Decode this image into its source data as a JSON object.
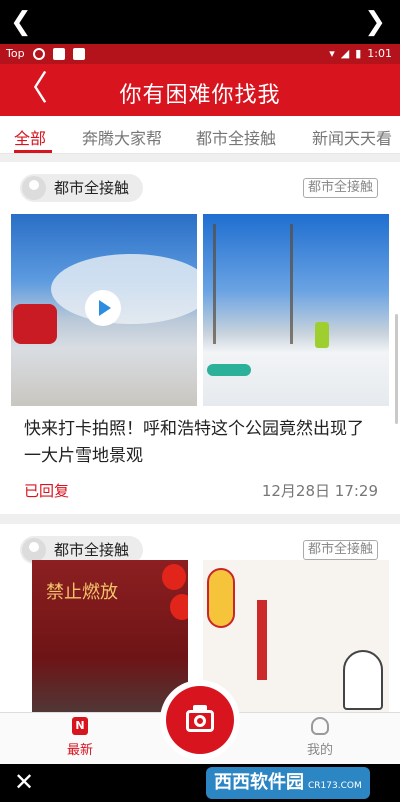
{
  "nav": {
    "prev_glyph": "❮",
    "next_glyph": "❯",
    "close_glyph": "✕"
  },
  "statusbar": {
    "left_app": "Top",
    "time": "1:01"
  },
  "header": {
    "back_glyph": "〈",
    "title": "你有困难你找我"
  },
  "tabs": [
    {
      "label": "全部",
      "active": true
    },
    {
      "label": "奔腾大家帮",
      "active": false
    },
    {
      "label": "都市全接触",
      "active": false
    },
    {
      "label": "新闻天天看",
      "active": false
    }
  ],
  "posts": [
    {
      "source": "都市全接触",
      "tag": "都市全接触",
      "headline": "快来打卡拍照！呼和浩特这个公园竟然出现了一大片雪地景观",
      "status": "已回复",
      "datetime": "12月28日 17:29"
    },
    {
      "source": "都市全接触",
      "tag": "都市全接触",
      "image_text": "禁止燃放"
    }
  ],
  "bottombar": {
    "news_label": "最新",
    "news_icon": "N",
    "mine_label": "我的"
  },
  "watermark": {
    "main": "西西软件园",
    "sub": "CR173.COM"
  },
  "colors": {
    "brand_red": "#d8141f",
    "status_red": "#b4131b"
  }
}
